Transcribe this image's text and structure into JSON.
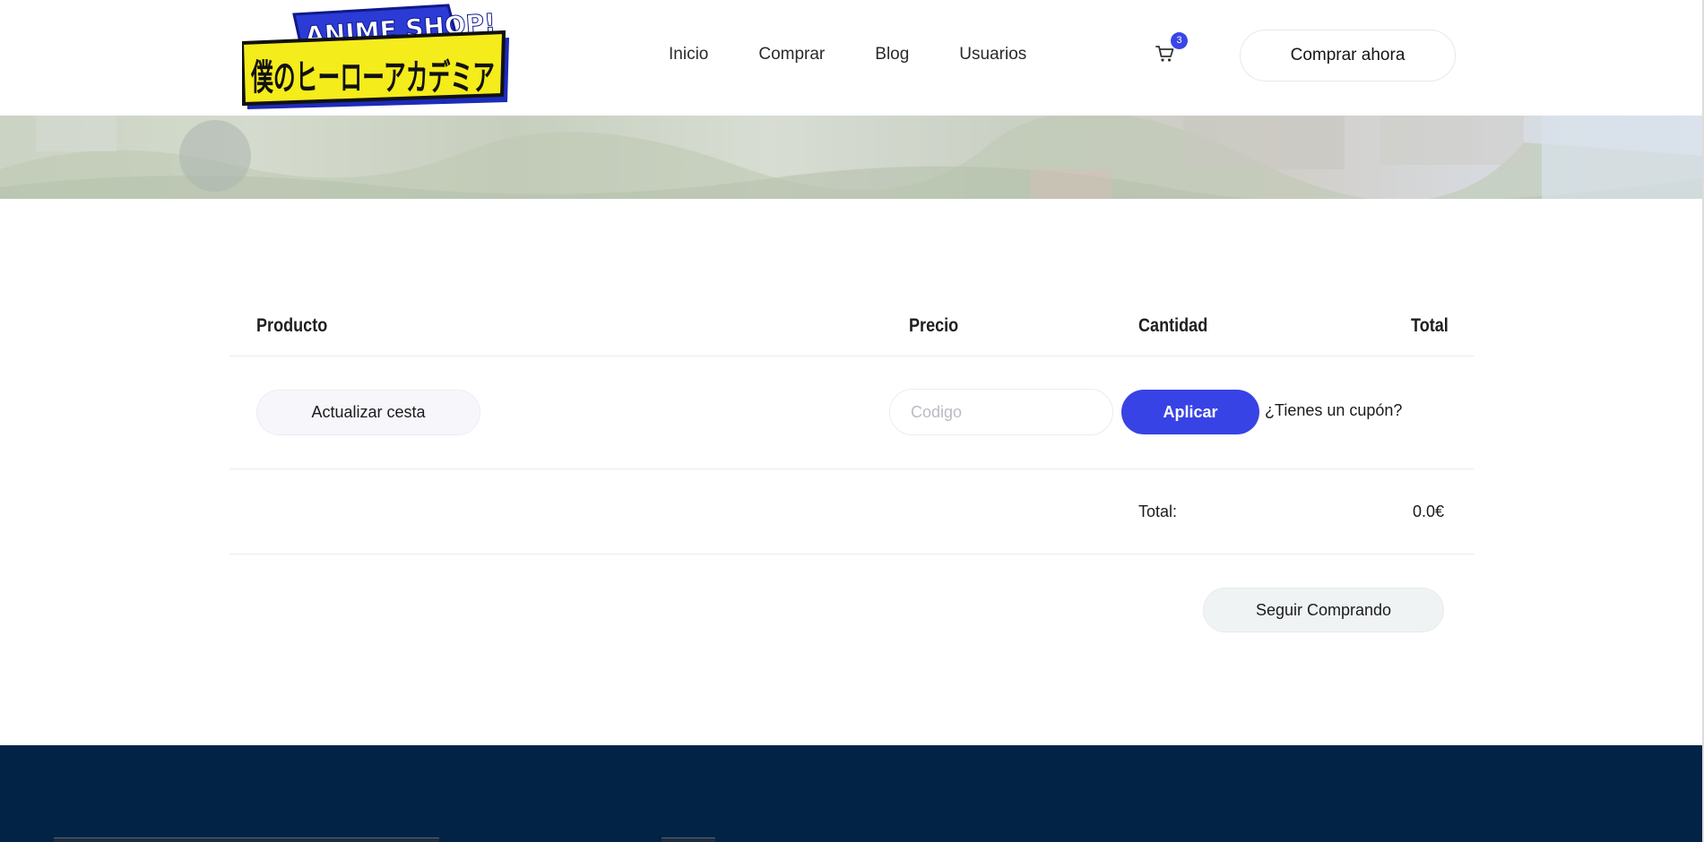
{
  "header": {
    "logo_text_top": "ANIME SHOP!",
    "logo_text_main": "僕のヒーローアカデミア",
    "nav": [
      "Inicio",
      "Comprar",
      "Blog",
      "Usuarios"
    ],
    "cart_count": "3",
    "cta_label": "Comprar ahora"
  },
  "cart_table": {
    "headers": {
      "product": "Producto",
      "price": "Precio",
      "quantity": "Cantidad",
      "total": "Total"
    },
    "update_label": "Actualizar cesta",
    "coupon_placeholder": "Codigo",
    "apply_label": "Aplicar",
    "coupon_question": "¿Tienes un cupón?",
    "total_label": "Total:",
    "total_value": "0.0€",
    "continue_label": "Seguir Comprando"
  },
  "colors": {
    "accent": "#3843e5",
    "footer_bg": "#022246",
    "badge": "#3a46e6"
  },
  "icons": {
    "cart": "shopping-cart-icon"
  }
}
